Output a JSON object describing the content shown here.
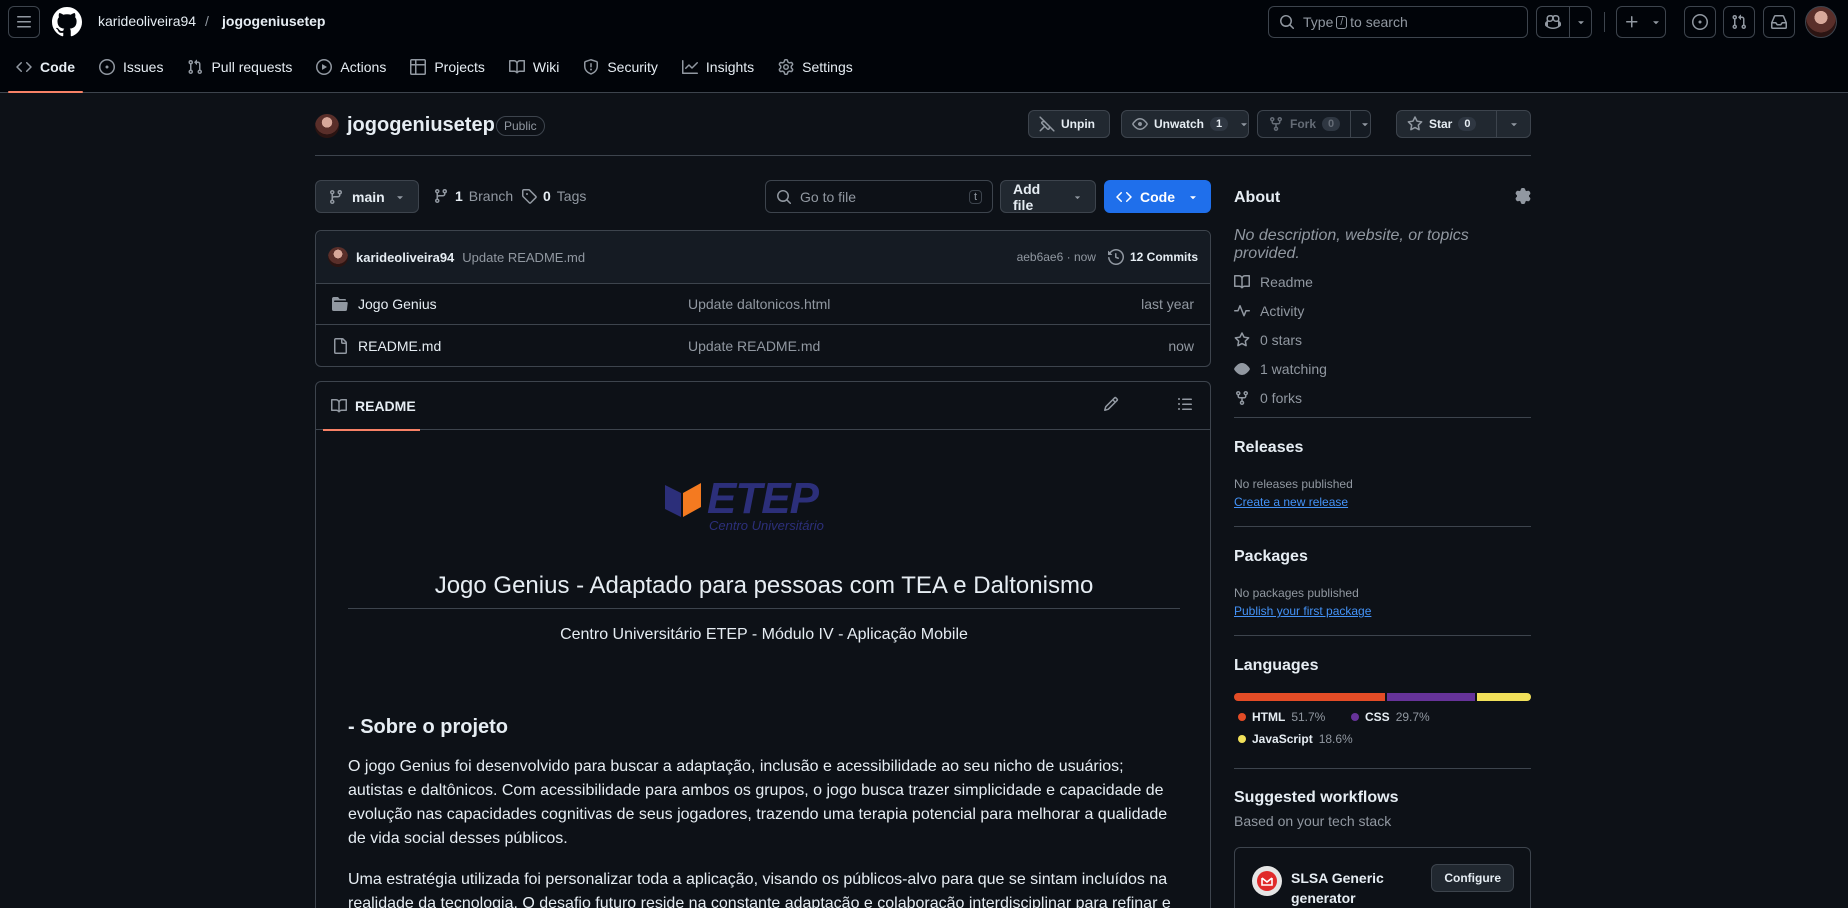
{
  "header": {
    "owner": "karideoliveira94",
    "separator": "/",
    "repo": "jogogeniusetep",
    "search_before": "Type",
    "search_key": "/",
    "search_after": "to search"
  },
  "nav": {
    "tabs": [
      {
        "label": "Code",
        "icon": "code-icon",
        "selected": true
      },
      {
        "label": "Issues",
        "icon": "issue-icon"
      },
      {
        "label": "Pull requests",
        "icon": "pull-request-icon"
      },
      {
        "label": "Actions",
        "icon": "play-icon"
      },
      {
        "label": "Projects",
        "icon": "table-icon"
      },
      {
        "label": "Wiki",
        "icon": "book-icon"
      },
      {
        "label": "Security",
        "icon": "shield-icon"
      },
      {
        "label": "Insights",
        "icon": "graph-icon"
      },
      {
        "label": "Settings",
        "icon": "gear-icon"
      }
    ]
  },
  "repo": {
    "name": "jogogeniusetep",
    "visibility": "Public",
    "unpin_label": "Unpin",
    "unwatch_label": "Unwatch",
    "watch_count": "1",
    "fork_label": "Fork",
    "fork_count": "0",
    "star_label": "Star",
    "star_count": "0"
  },
  "filenav": {
    "branch": "main",
    "branch_count": "1",
    "branch_label": "Branch",
    "tag_count": "0",
    "tag_label": "Tags",
    "goto_placeholder": "Go to file",
    "goto_key": "t",
    "add_file_label": "Add file",
    "code_label": "Code"
  },
  "commit": {
    "author": "karideoliveira94",
    "message": "Update README.md",
    "meta": "aeb6ae6 · now",
    "commits_label": "12 Commits"
  },
  "files": [
    {
      "name": "Jogo Genius",
      "type": "folder",
      "message": "Update daltonicos.html",
      "date": "last year"
    },
    {
      "name": "README.md",
      "type": "file",
      "message": "Update README.md",
      "date": "now"
    }
  ],
  "readme": {
    "tab_label": "README",
    "logo_text": "ETEP",
    "logo_sub": "Centro Universitário",
    "h1": "Jogo Genius - Adaptado para pessoas com TEA e Daltonismo",
    "subtitle": "Centro Universitário ETEP - Módulo IV - Aplicação Mobile",
    "h2": "- Sobre o projeto",
    "p1": "O jogo Genius foi desenvolvido para buscar a adaptação, inclusão e acessibilidade ao seu nicho de usuários; autistas e daltônicos. Com acessibilidade para ambos os grupos, o jogo busca trazer simplicidade e capacidade de evolução nas capacidades cognitivas de seus jogadores, trazendo uma terapia potencial para melhorar a qualidade de vida social desses públicos.",
    "p2": "Uma estratégia utilizada foi personalizar toda a aplicação, visando os públicos-alvo para que se sintam incluídos na realidade da tecnologia. O desafio futuro reside na constante adaptação e colaboração interdisciplinar para refinar e"
  },
  "sidebar": {
    "about_title": "About",
    "description": "No description, website, or topics provided.",
    "items": [
      {
        "label": "Readme",
        "icon": "book-icon"
      },
      {
        "label": "Activity",
        "icon": "pulse-icon"
      },
      {
        "label": "0 stars",
        "icon": "star-icon"
      },
      {
        "label": "1 watching",
        "icon": "eye-icon"
      },
      {
        "label": "0 forks",
        "icon": "fork-icon"
      }
    ],
    "releases_title": "Releases",
    "releases_empty": "No releases published",
    "releases_link": "Create a new release",
    "packages_title": "Packages",
    "packages_empty": "No packages published",
    "packages_link": "Publish your first package",
    "languages_title": "Languages",
    "languages": [
      {
        "name": "HTML",
        "percent": "51.7%",
        "value": 51.7,
        "color": "#e34c26"
      },
      {
        "name": "CSS",
        "percent": "29.7%",
        "value": 29.7,
        "color": "#663399"
      },
      {
        "name": "JavaScript",
        "percent": "18.6%",
        "value": 18.6,
        "color": "#f1e05a"
      }
    ],
    "workflows_title": "Suggested workflows",
    "workflows_sub": "Based on your tech stack",
    "workflow_name": "SLSA Generic generator",
    "workflow_button": "Configure"
  }
}
